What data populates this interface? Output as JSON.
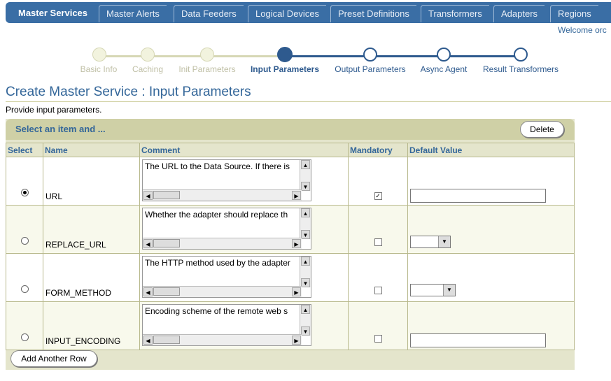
{
  "tabs": [
    "Master Services",
    "Master Alerts",
    "Data Feeders",
    "Logical Devices",
    "Preset Definitions",
    "Transformers",
    "Adapters",
    "Regions"
  ],
  "welcome": "Welcome orc",
  "train": [
    {
      "label": "Basic Info",
      "state": "done"
    },
    {
      "label": "Caching",
      "state": "done"
    },
    {
      "label": "Init Parameters",
      "state": "done"
    },
    {
      "label": "Input Parameters",
      "state": "current"
    },
    {
      "label": "Output Parameters",
      "state": "next"
    },
    {
      "label": "Async Agent",
      "state": "next"
    },
    {
      "label": "Result Transformers",
      "state": "next"
    }
  ],
  "page_title": "Create Master Service : Input Parameters",
  "instruction": "Provide input parameters.",
  "table_header": "Select an item and ...",
  "delete_label": "Delete",
  "columns": [
    "Select",
    "Name",
    "Comment",
    "Mandatory",
    "Default Value"
  ],
  "rows": [
    {
      "name": "URL",
      "comment": "The URL to the Data Source. If there is",
      "selected": true,
      "mandatory": true,
      "default_type": "text"
    },
    {
      "name": "REPLACE_URL",
      "comment": "Whether the adapter should replace th",
      "selected": false,
      "mandatory": false,
      "default_type": "select"
    },
    {
      "name": "FORM_METHOD",
      "comment": "The HTTP method used by the adapter",
      "selected": false,
      "mandatory": false,
      "default_type": "select"
    },
    {
      "name": "INPUT_ENCODING",
      "comment": "Encoding scheme of the remote web s",
      "selected": false,
      "mandatory": false,
      "default_type": "text"
    }
  ],
  "add_row_label": "Add Another Row",
  "colors": {
    "brand": "#3a6ea5",
    "title": "#336699",
    "panel": "#e4e5cc",
    "panel_head": "#cfd0a6"
  }
}
